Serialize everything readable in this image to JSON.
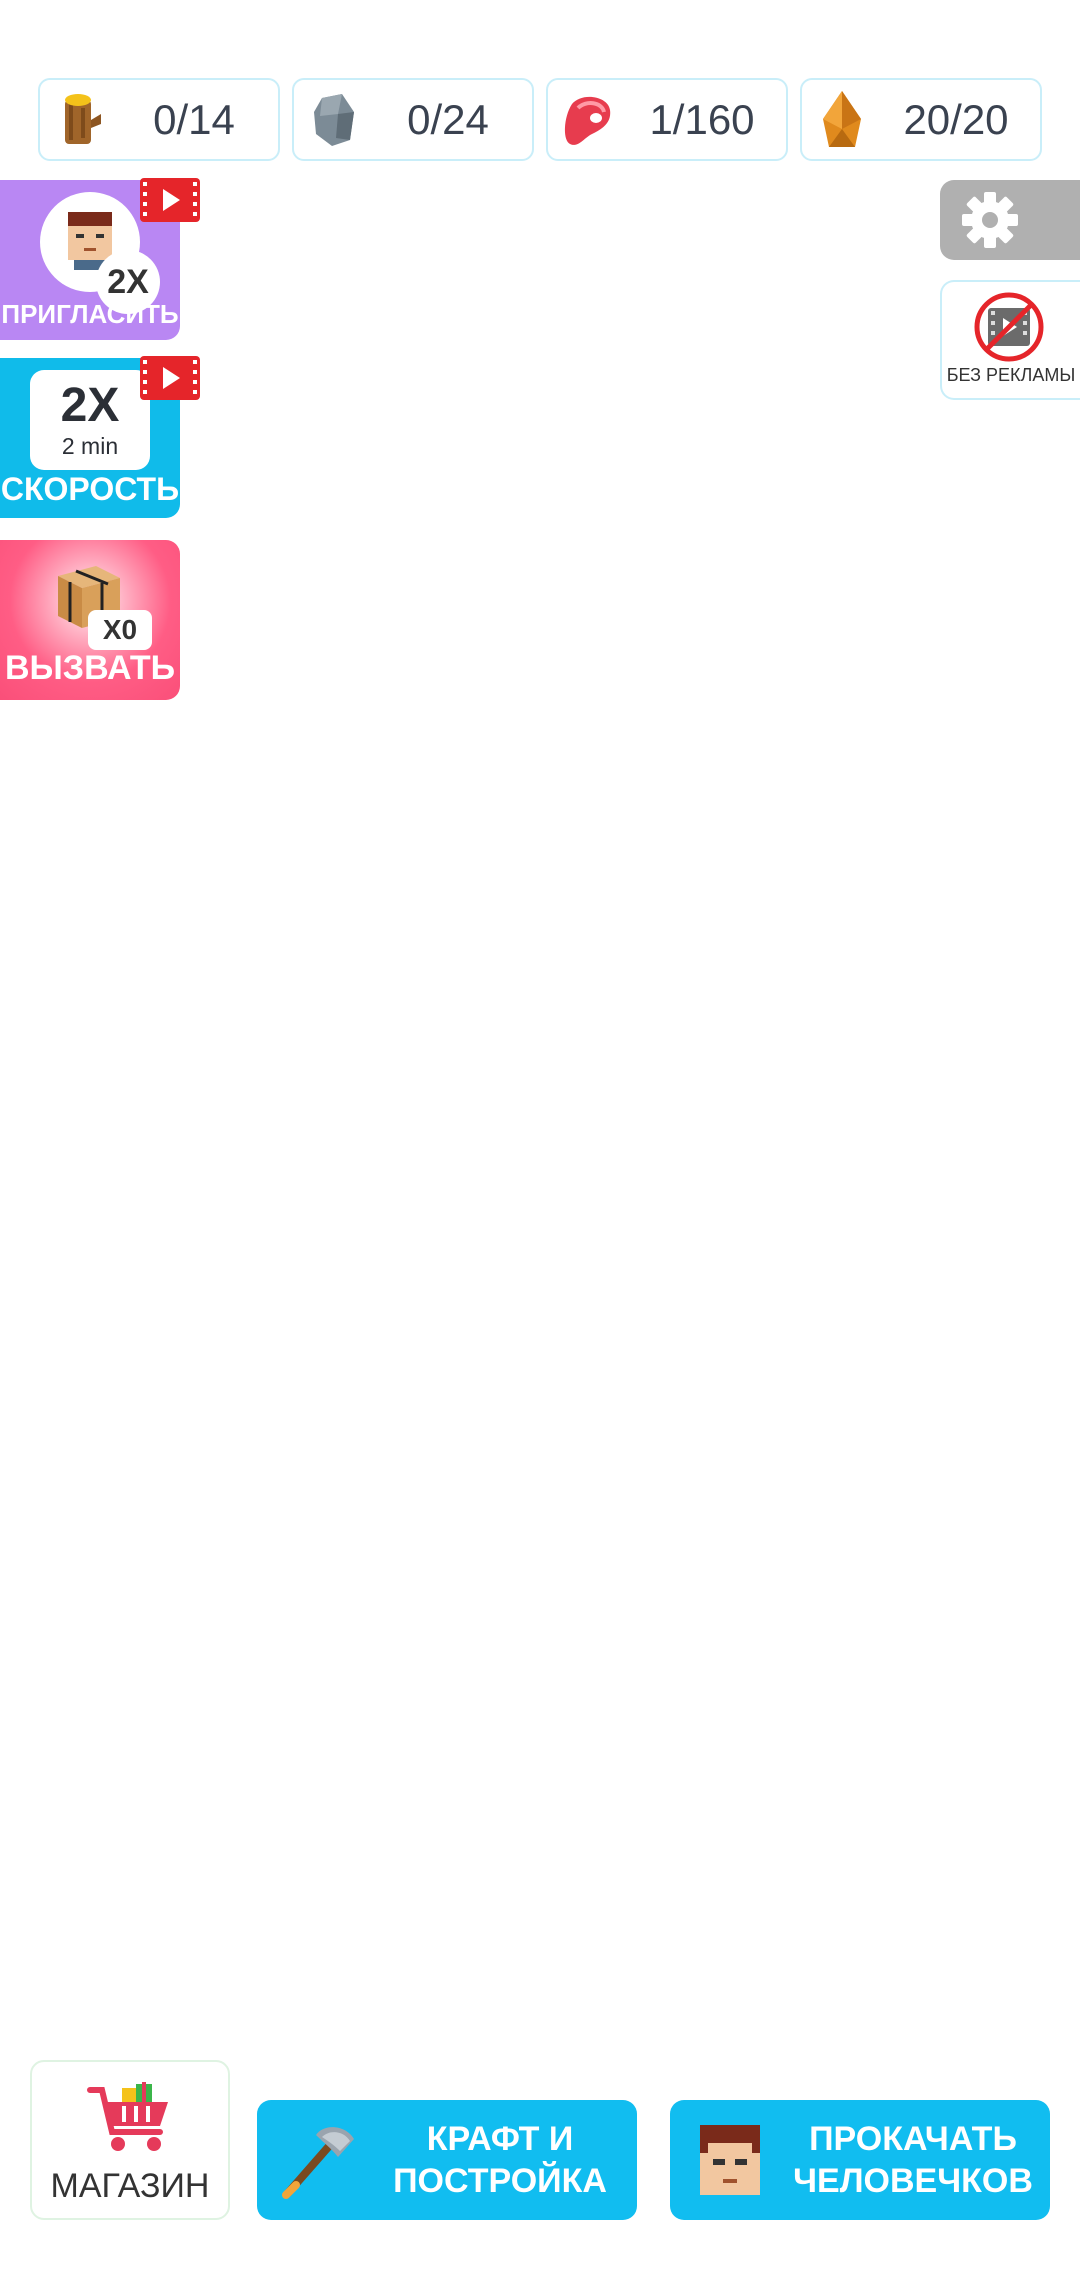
{
  "resources": [
    {
      "icon": "wood-log-icon",
      "value": "0/14"
    },
    {
      "icon": "stone-icon",
      "value": "0/24"
    },
    {
      "icon": "meat-icon",
      "value": "1/160"
    },
    {
      "icon": "amber-icon",
      "value": "20/20"
    }
  ],
  "invite": {
    "multiplier": "2X",
    "label": "ПРИГЛАСИТЬ"
  },
  "speed": {
    "multiplier": "2X",
    "duration": "2 min",
    "label": "СКОРОСТЬ"
  },
  "summon": {
    "count": "X0",
    "label": "ВЫЗВАТЬ"
  },
  "no_ads": {
    "label": "БЕЗ РЕКЛАМЫ"
  },
  "shop": {
    "label": "МАГАЗИН"
  },
  "craft": {
    "line1": "КРАФТ И",
    "line2": "ПОСТРОЙКА"
  },
  "upgrade": {
    "line1": "ПРОКАЧАТЬ",
    "line2": "ЧЕЛОВЕЧКОВ"
  },
  "colors": {
    "invite_bg": "#b987f3",
    "speed_bg": "#10bbea",
    "summon_bg": "#fa4f79",
    "button_blue": "#11bdf0",
    "settings_bg": "#b0b0b0"
  }
}
